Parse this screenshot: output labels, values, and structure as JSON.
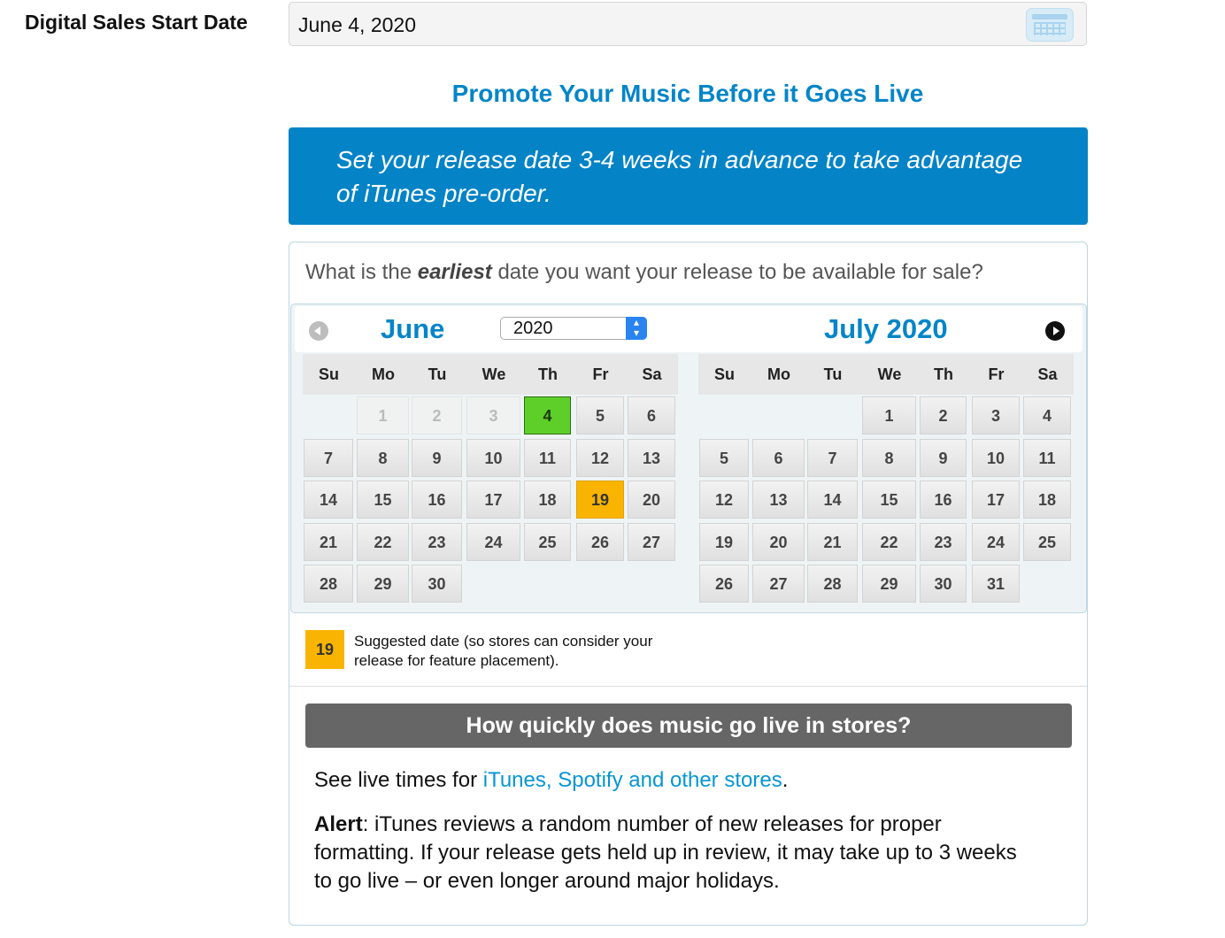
{
  "field": {
    "label": "Digital Sales Start Date",
    "value": "June 4, 2020",
    "icon": "calendar-icon"
  },
  "promo": {
    "title": "Promote Your Music Before it Goes Live",
    "banner": "Set your release date 3-4 weeks in advance to take advantage of iTunes pre-order."
  },
  "question": {
    "prefix": "What is the ",
    "emphasis": "earliest",
    "suffix": " date you want your release to be available for sale?"
  },
  "calendar": {
    "weekdays": [
      "Su",
      "Mo",
      "Tu",
      "We",
      "Th",
      "Fr",
      "Sa"
    ],
    "left": {
      "month": "June",
      "year_select": "2020",
      "first_weekday": 1,
      "days_in_month": 30,
      "disabled_days": [
        1,
        2,
        3
      ],
      "selected_day": 4,
      "suggested_day": 19
    },
    "right": {
      "title": "July 2020",
      "first_weekday": 3,
      "days_in_month": 31
    },
    "prev_icon": "prev-arrow-icon",
    "next_icon": "next-arrow-icon"
  },
  "legend": {
    "day": "19",
    "text": "Suggested date (so stores can consider your release for feature placement)."
  },
  "golive": {
    "button": "How quickly does music go live in stores?",
    "live_prefix": "See live times for ",
    "live_link": "iTunes, Spotify and other stores",
    "live_suffix": ".",
    "alert_label": "Alert",
    "alert_text": ": iTunes reviews a random number of new releases for proper formatting. If your release gets held up in review, it may take up to 3 weeks to go live – or even longer around major holidays."
  },
  "colors": {
    "accent": "#0585c8",
    "selected": "#5ecf29",
    "suggested": "#f8b400"
  }
}
